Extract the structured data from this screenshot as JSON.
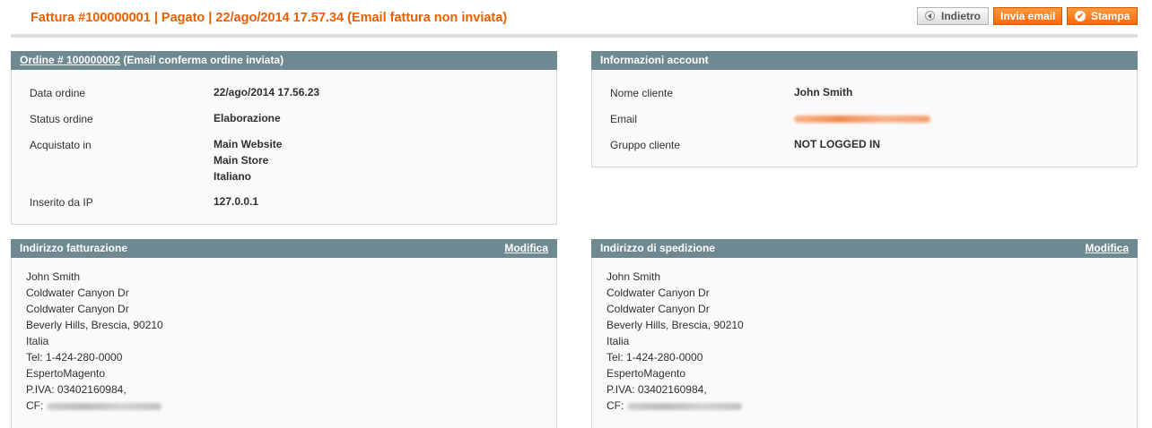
{
  "header": {
    "title": "Fattura #100000001 | Pagato | 22/ago/2014 17.57.34 (Email fattura non inviata)",
    "buttons": {
      "back": "Indietro",
      "send_email": "Invia email",
      "print": "Stampa"
    }
  },
  "order_box": {
    "title_link": "Ordine # 100000002",
    "title_suffix": " (Email conferma ordine inviata)",
    "rows": {
      "date": {
        "label": "Data ordine",
        "value": "22/ago/2014 17.56.23"
      },
      "status": {
        "label": "Status ordine",
        "value": "Elaborazione"
      },
      "purchased": {
        "label": "Acquistato in",
        "value": [
          "Main Website",
          "Main Store",
          "Italiano"
        ]
      },
      "ip": {
        "label": "Inserito da IP",
        "value": "127.0.0.1"
      }
    }
  },
  "account_box": {
    "title": "Informazioni account",
    "rows": {
      "name": {
        "label": "Nome cliente",
        "value": "John Smith"
      },
      "email": {
        "label": "Email"
      },
      "group": {
        "label": "Gruppo cliente",
        "value": "NOT LOGGED IN"
      }
    }
  },
  "billing_box": {
    "title": "Indirizzo fatturazione",
    "edit": "Modifica",
    "lines": [
      "John Smith",
      "Coldwater Canyon Dr",
      "Coldwater Canyon Dr",
      "Beverly Hills, Brescia, 90210",
      "Italia",
      "Tel: 1-424-280-0000",
      "EspertoMagento",
      "P.IVA: 03402160984,",
      "CF:"
    ]
  },
  "shipping_box": {
    "title": "Indirizzo di spedizione",
    "edit": "Modifica",
    "lines": [
      "John Smith",
      "Coldwater Canyon Dr",
      "Coldwater Canyon Dr",
      "Beverly Hills, Brescia, 90210",
      "Italia",
      "Tel: 1-424-280-0000",
      "EspertoMagento",
      "P.IVA: 03402160984,",
      "CF:"
    ]
  },
  "colors": {
    "accent": "#eb5e00",
    "box_header": "#6f8992"
  },
  "icons": {
    "back": "back-arrow-icon",
    "print": "print-check-icon"
  }
}
